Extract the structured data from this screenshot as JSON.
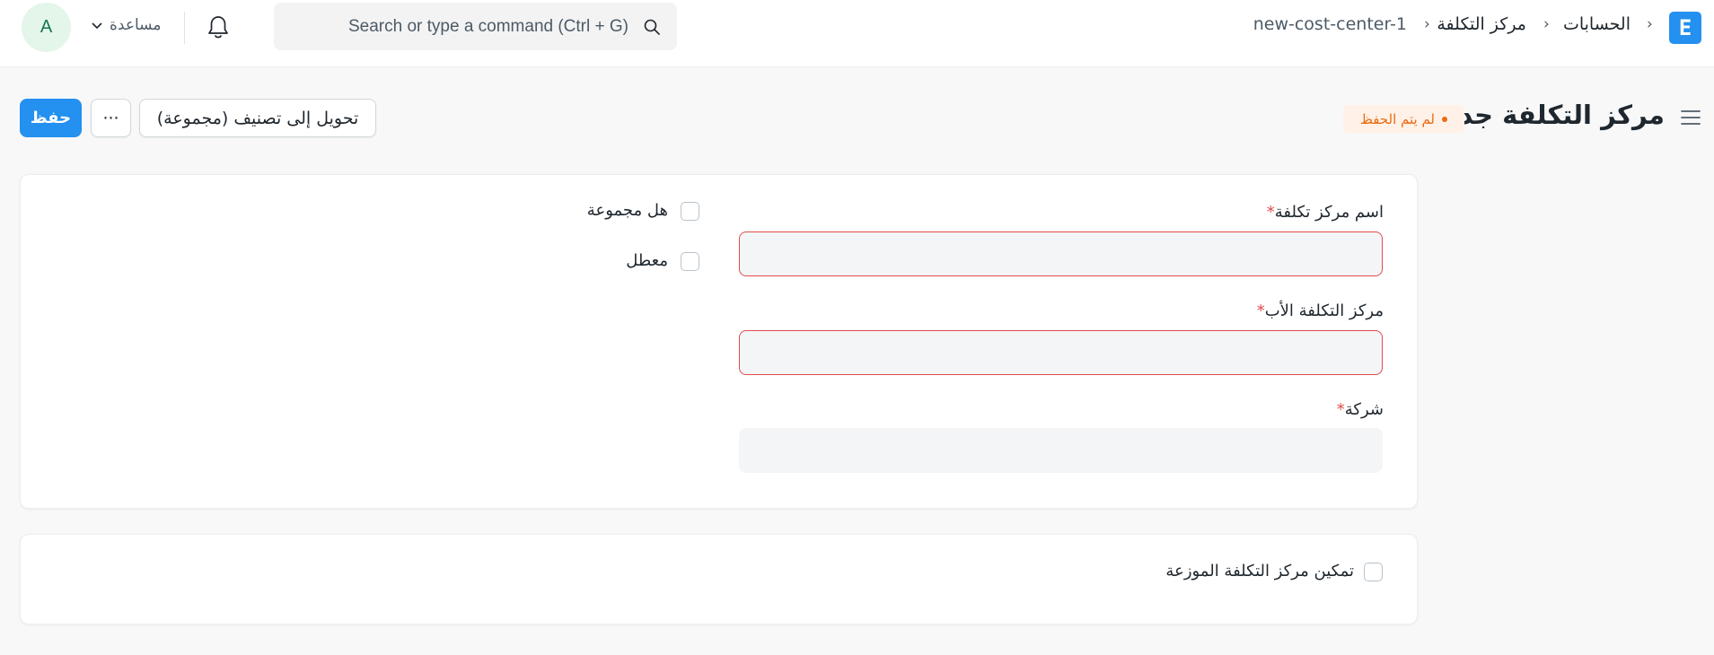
{
  "app": {
    "logo_letter": "E"
  },
  "breadcrumb": {
    "items": [
      "الحسابات",
      "مركز التكلفة",
      "new-cost-center-1"
    ]
  },
  "search": {
    "placeholder": "Search or type a command (Ctrl + G)"
  },
  "header": {
    "help_label": "مساعدة",
    "avatar_letter": "A"
  },
  "page": {
    "title": "مركز التكلفة جديد",
    "status": "لم يتم الحفظ"
  },
  "actions": {
    "save_label": "حفظ",
    "more_label": "···",
    "convert_label": "تحويل إلى تصنيف (مجموعة)"
  },
  "form": {
    "cost_center_name": {
      "label": "اسم مركز تكلفة",
      "value": ""
    },
    "parent_cost_center": {
      "label": "مركز التكلفة الأب",
      "value": ""
    },
    "company": {
      "label": "شركة",
      "value": ""
    },
    "is_group": {
      "label": "هل مجموعة",
      "checked": false
    },
    "disabled": {
      "label": "معطل",
      "checked": false
    },
    "distributed": {
      "label": "تمكين مركز التكلفة الموزعة",
      "checked": false
    },
    "required_mark": "*"
  },
  "colors": {
    "primary": "#2490ef",
    "required": "#e24c4c",
    "status_orange": "#e86c13"
  }
}
